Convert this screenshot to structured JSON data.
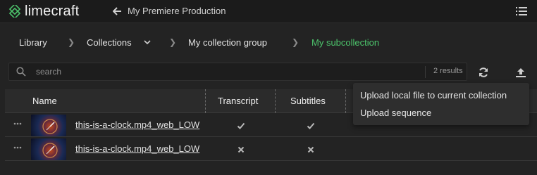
{
  "header": {
    "logo_text": "limecraft",
    "production_title": "My Premiere Production"
  },
  "breadcrumb": {
    "items": [
      {
        "label": "Library"
      },
      {
        "label": "Collections"
      },
      {
        "label": "My collection group"
      },
      {
        "label": "My subcollection"
      }
    ]
  },
  "search": {
    "placeholder": "search",
    "results_text": "2 results"
  },
  "table": {
    "columns": {
      "name": "Name",
      "transcript": "Transcript",
      "subtitles": "Subtitles"
    },
    "rows": [
      {
        "name": "this-is-a-clock.mp4_web_LOW",
        "transcript": "check",
        "subtitles": "check"
      },
      {
        "name": "this-is-a-clock.mp4_web_LOW",
        "transcript": "cross",
        "subtitles": "cross"
      }
    ]
  },
  "upload_menu": {
    "items": [
      {
        "label": "Upload local file to current collection"
      },
      {
        "label": "Upload sequence"
      }
    ]
  },
  "colors": {
    "accent": "#4cc36b",
    "background": "#232323",
    "topbar": "#1b1b1b"
  }
}
